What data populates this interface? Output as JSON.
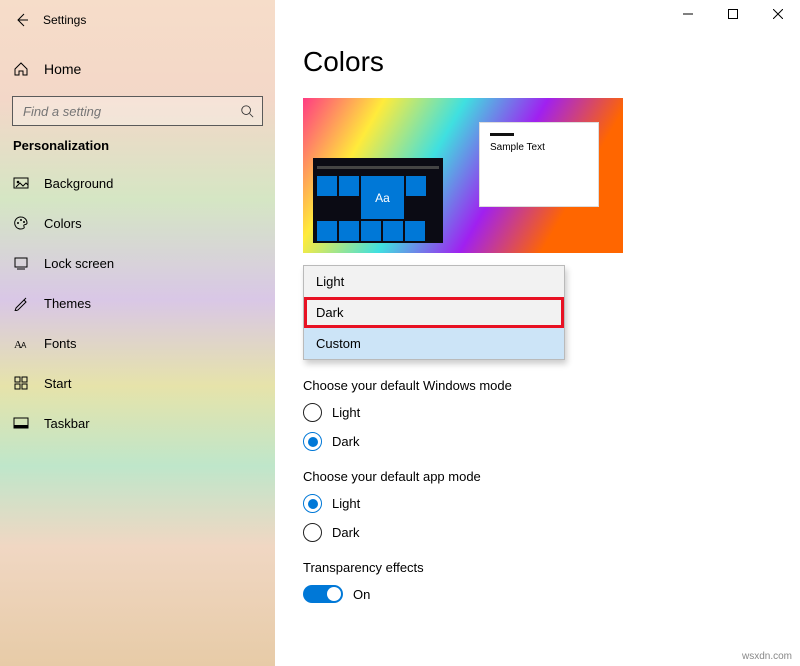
{
  "window": {
    "title": "Settings"
  },
  "sidebar": {
    "home": "Home",
    "search_placeholder": "Find a setting",
    "section": "Personalization",
    "items": [
      {
        "label": "Background"
      },
      {
        "label": "Colors"
      },
      {
        "label": "Lock screen"
      },
      {
        "label": "Themes"
      },
      {
        "label": "Fonts"
      },
      {
        "label": "Start"
      },
      {
        "label": "Taskbar"
      }
    ]
  },
  "main": {
    "title": "Colors",
    "preview": {
      "sample_text": "Sample Text",
      "aa": "Aa"
    },
    "dropdown": {
      "options": [
        {
          "label": "Light"
        },
        {
          "label": "Dark"
        },
        {
          "label": "Custom"
        }
      ],
      "highlighted_index": 1,
      "hovered_index": 2
    },
    "windows_mode": {
      "label": "Choose your default Windows mode",
      "options": [
        "Light",
        "Dark"
      ],
      "selected": "Dark"
    },
    "app_mode": {
      "label": "Choose your default app mode",
      "options": [
        "Light",
        "Dark"
      ],
      "selected": "Light"
    },
    "transparency": {
      "label": "Transparency effects",
      "value": "On"
    }
  },
  "watermark": "wsxdn.com"
}
